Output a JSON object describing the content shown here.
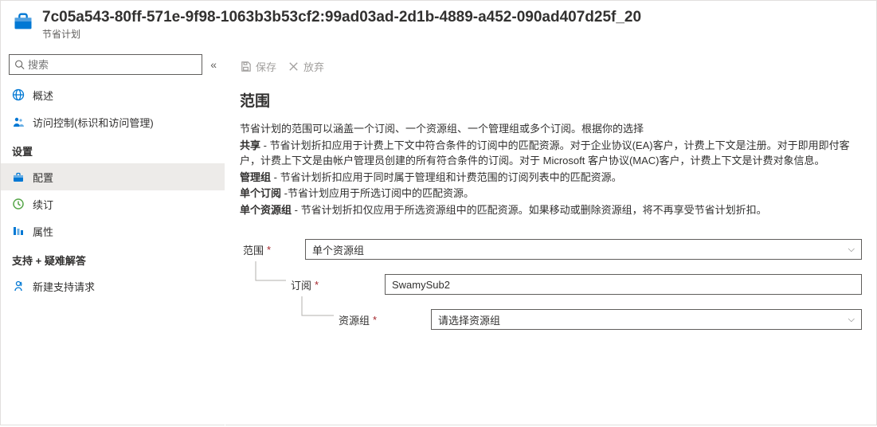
{
  "header": {
    "title": "7c05a543-80ff-571e-9f98-1063b3b53cf2:99ad03ad-2d1b-4889-a452-090ad407d25f_20",
    "subtitle": "节省计划"
  },
  "sidebar": {
    "search_placeholder": "搜索",
    "overview": "概述",
    "access_control": "访问控制(标识和访问管理)",
    "section_settings": "设置",
    "configuration": "配置",
    "renew": "续订",
    "properties": "属性",
    "section_support": "支持 + 疑难解答",
    "support_request": "新建支持请求"
  },
  "toolbar": {
    "save": "保存",
    "discard": "放弃"
  },
  "section": {
    "title": "范围",
    "p_intro": "节省计划的范围可以涵盖一个订阅、一个资源组、一个管理组或多个订阅。根据你的选择",
    "p_share_label": "共享",
    "p_share_body": " - 节省计划折扣应用于计费上下文中符合条件的订阅中的匹配资源。对于企业协议(EA)客户，计费上下文是注册。对于即用即付客户，计费上下文是由帐户管理员创建的所有符合条件的订阅。对于 Microsoft 客户协议(MAC)客户，计费上下文是计费对象信息。",
    "p_mg_label": "管理组",
    "p_mg_body": " - 节省计划折扣应用于同时属于管理组和计费范围的订阅列表中的匹配资源。",
    "p_single_sub_label": "单个订阅",
    "p_single_sub_body": " -节省计划应用于所选订阅中的匹配资源。",
    "p_single_rg_label": "单个资源组",
    "p_single_rg_body": " - 节省计划折扣仅应用于所选资源组中的匹配资源。如果移动或删除资源组，将不再享受节省计划折扣。"
  },
  "form": {
    "scope_label": "范围",
    "scope_value": "单个资源组",
    "subscription_label": "订阅",
    "subscription_value": "SwamySub2",
    "resource_group_label": "资源组",
    "resource_group_placeholder": "请选择资源组"
  }
}
